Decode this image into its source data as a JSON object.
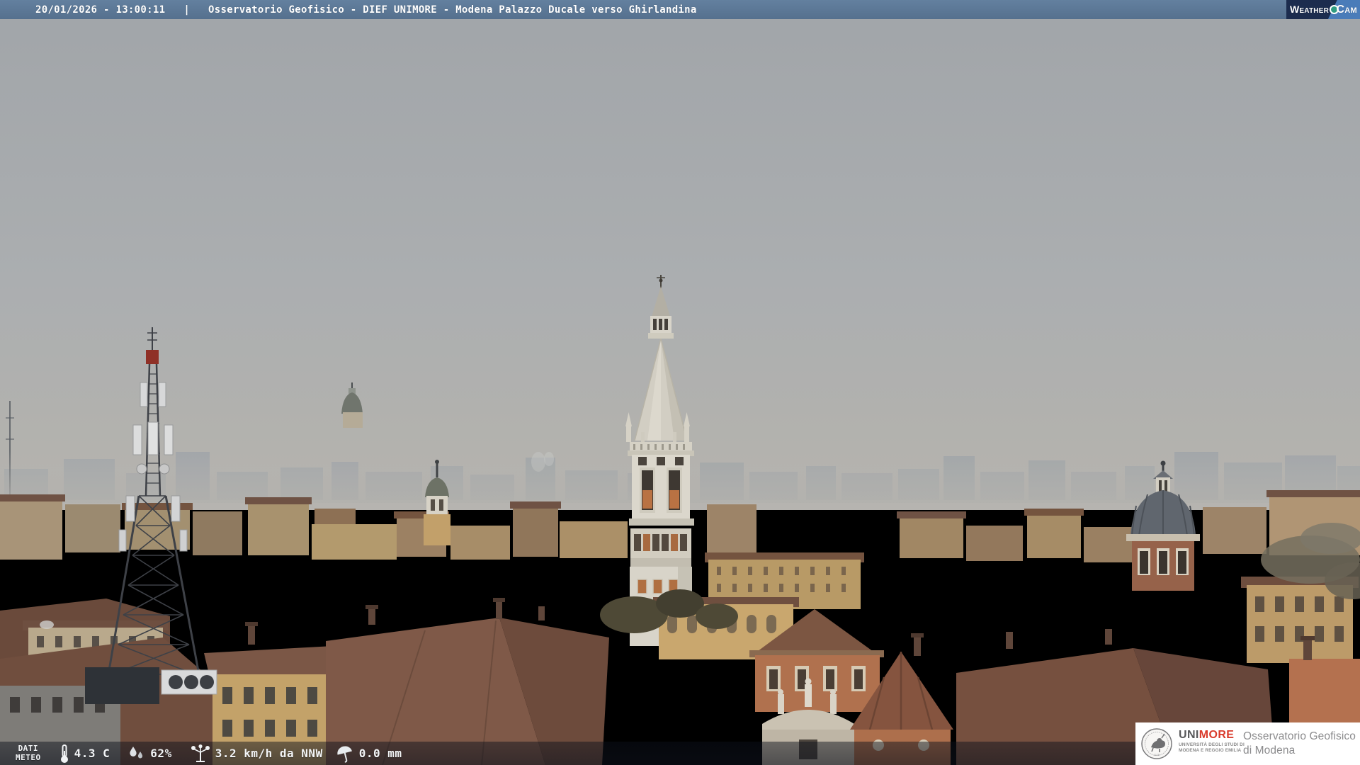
{
  "header": {
    "timestamp": "20/01/2026 - 13:00:11",
    "separator": "|",
    "title": "Osservatorio Geofisico - DIEF UNIMORE - Modena Palazzo Ducale verso Ghirlandina",
    "bg_color": "#5b7492"
  },
  "weathercam_logo": {
    "weather": "Weather",
    "cam": "Cam",
    "navy": "#1c2c4e",
    "blue": "#4a7cb9",
    "lens_green": "#2f9d82"
  },
  "meteo_bar": {
    "label_line1": "DATI",
    "label_line2": "METEO",
    "temperature": "4.3 C",
    "humidity": "62%",
    "wind": "3.2 km/h da NNW",
    "precipitation": "0.0 mm"
  },
  "unimore_box": {
    "brand_uni": "UNI",
    "brand_more": "MORE",
    "subtitle_line1": "UNIVERSITÀ DEGLI STUDI DI",
    "subtitle_line2": "MODENA E REGGIO EMILIA",
    "right_line1": "Osservatorio Geofisico",
    "right_line2": "di Modena",
    "brand_red": "#d93a2b"
  },
  "scene": {
    "description": "Overcast winter view over Modena rooftops toward the Ghirlandina tower; telecom lattice tower at left, church domes at center and right, hazy skyline of modern blocks on the horizon",
    "colors": {
      "sky_top": "#a1a5a9",
      "sky_horizon": "#b5b3ae",
      "haze": "#b1b0ac",
      "distant_building": "#99a0a7",
      "roof_terracotta": "#7f5948",
      "facade_ochre": "#c9a76e",
      "facade_orange": "#b0714e",
      "tower_stone": "#d8d4c9",
      "dome_lead": "#60666e",
      "tree_olive": "#4e4936"
    }
  }
}
